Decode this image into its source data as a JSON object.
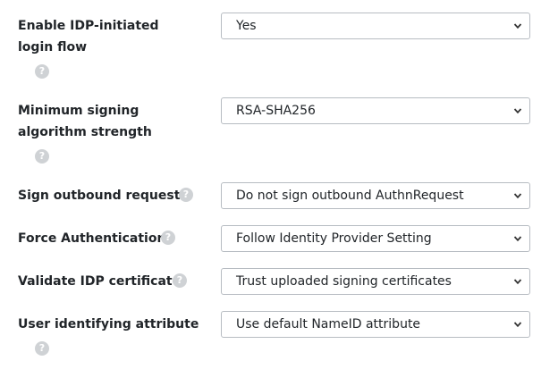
{
  "settings": [
    {
      "label": "Enable IDP-initiated login flow",
      "value": "Yes"
    },
    {
      "label": "Minimum signing algorithm strength",
      "value": "RSA-SHA256"
    },
    {
      "label": "Sign outbound requests",
      "value": "Do not sign outbound AuthnRequest"
    },
    {
      "label": "Force Authentication",
      "value": "Follow Identity Provider Setting"
    },
    {
      "label": "Validate IDP certificate",
      "value": "Trust uploaded signing certificates"
    },
    {
      "label": "User identifying attribute",
      "value": "Use default NameID attribute"
    }
  ],
  "help_icon_glyph": "?",
  "icons": {
    "help": "question-circle-icon",
    "dropdown": "chevron-down-icon"
  },
  "colors": {
    "help_icon": "#cfd2d5",
    "border": "#b7bcc2",
    "text": "#212529"
  }
}
